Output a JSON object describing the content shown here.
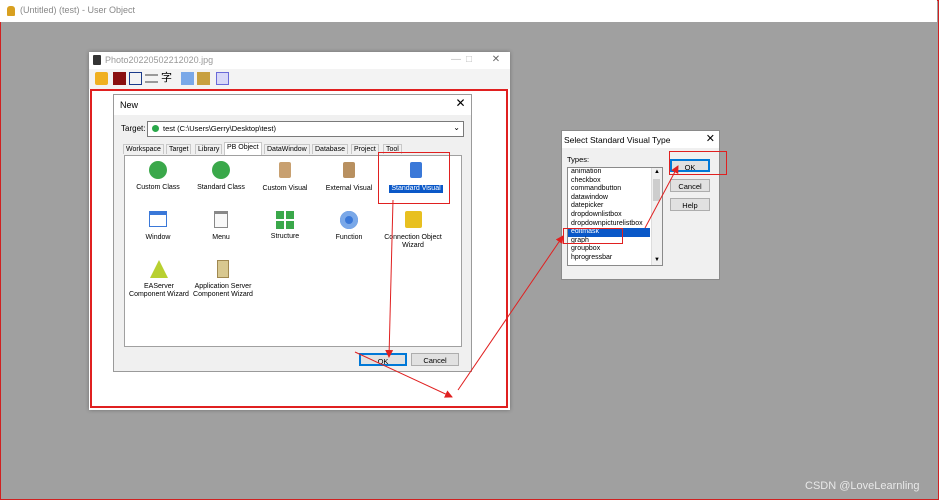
{
  "app": {
    "title": "(Untitled) (test) - User Object"
  },
  "photo_window": {
    "title": "Photo20220502212020.jpg"
  },
  "new_dialog": {
    "title": "New",
    "target_label": "Target:",
    "target_value": "test (C:\\Users\\Gerry\\Desktop\\test)",
    "tabs": [
      "Workspace",
      "Target",
      "Library",
      "PB Object",
      "DataWindow",
      "Database",
      "Project",
      "Tool"
    ],
    "active_tab": "PB Object",
    "items": [
      {
        "label": "Custom Class",
        "icon": "custom-class-icon"
      },
      {
        "label": "Standard Class",
        "icon": "standard-class-icon"
      },
      {
        "label": "Custom Visual",
        "icon": "custom-visual-icon"
      },
      {
        "label": "External Visual",
        "icon": "external-visual-icon"
      },
      {
        "label": "Standard Visual",
        "icon": "standard-visual-icon"
      },
      {
        "label": "Window",
        "icon": "window-icon"
      },
      {
        "label": "Menu",
        "icon": "menu-icon"
      },
      {
        "label": "Structure",
        "icon": "structure-icon"
      },
      {
        "label": "Function",
        "icon": "function-icon"
      },
      {
        "label": "Connection Object Wizard",
        "icon": "connection-wizard-icon"
      },
      {
        "label": "EAServer Component Wizard",
        "icon": "easerver-wizard-icon"
      },
      {
        "label": "Application Server Component Wizard",
        "icon": "appserver-wizard-icon"
      }
    ],
    "selected_item": "Standard Visual",
    "ok": "OK",
    "cancel": "Cancel"
  },
  "svt_dialog": {
    "title": "Select Standard Visual Type",
    "types_label": "Types:",
    "types": [
      "animation",
      "checkbox",
      "commandbutton",
      "datawindow",
      "datepicker",
      "dropdownlistbox",
      "dropdownpicturelistbox",
      "editmask",
      "graph",
      "groupbox",
      "hprogressbar"
    ],
    "selected": "editmask",
    "ok": "OK",
    "cancel": "Cancel",
    "help": "Help"
  },
  "watermark": "CSDN @LoveLearnling",
  "colors": {
    "accent": "#0a58c8",
    "annotation_red": "#e02020",
    "desktop_gray": "#a0a0a0"
  }
}
